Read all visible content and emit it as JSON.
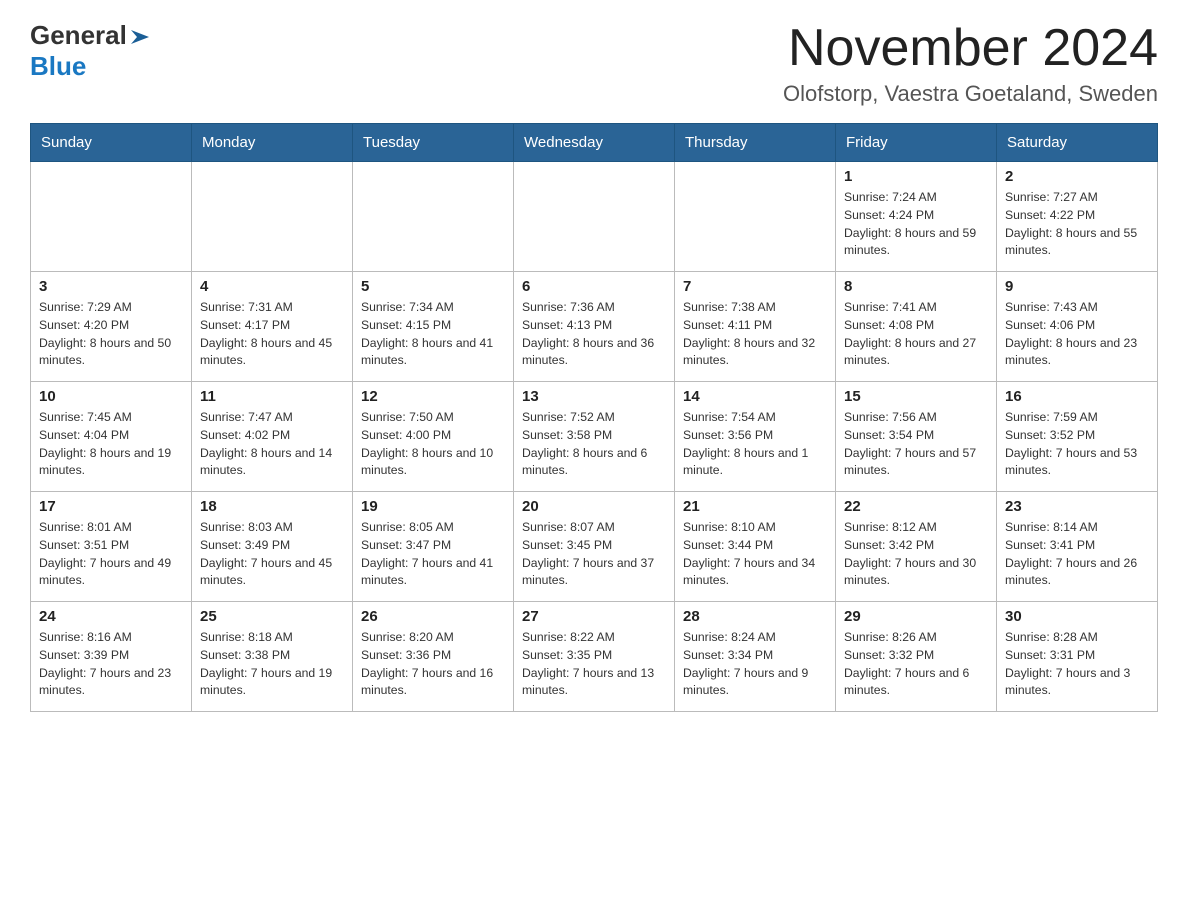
{
  "header": {
    "logo": {
      "text1": "General",
      "text2": "Blue"
    },
    "title": "November 2024",
    "subtitle": "Olofstorp, Vaestra Goetaland, Sweden"
  },
  "days_of_week": [
    "Sunday",
    "Monday",
    "Tuesday",
    "Wednesday",
    "Thursday",
    "Friday",
    "Saturday"
  ],
  "weeks": [
    [
      {
        "day": "",
        "info": ""
      },
      {
        "day": "",
        "info": ""
      },
      {
        "day": "",
        "info": ""
      },
      {
        "day": "",
        "info": ""
      },
      {
        "day": "",
        "info": ""
      },
      {
        "day": "1",
        "info": "Sunrise: 7:24 AM\nSunset: 4:24 PM\nDaylight: 8 hours and 59 minutes."
      },
      {
        "day": "2",
        "info": "Sunrise: 7:27 AM\nSunset: 4:22 PM\nDaylight: 8 hours and 55 minutes."
      }
    ],
    [
      {
        "day": "3",
        "info": "Sunrise: 7:29 AM\nSunset: 4:20 PM\nDaylight: 8 hours and 50 minutes."
      },
      {
        "day": "4",
        "info": "Sunrise: 7:31 AM\nSunset: 4:17 PM\nDaylight: 8 hours and 45 minutes."
      },
      {
        "day": "5",
        "info": "Sunrise: 7:34 AM\nSunset: 4:15 PM\nDaylight: 8 hours and 41 minutes."
      },
      {
        "day": "6",
        "info": "Sunrise: 7:36 AM\nSunset: 4:13 PM\nDaylight: 8 hours and 36 minutes."
      },
      {
        "day": "7",
        "info": "Sunrise: 7:38 AM\nSunset: 4:11 PM\nDaylight: 8 hours and 32 minutes."
      },
      {
        "day": "8",
        "info": "Sunrise: 7:41 AM\nSunset: 4:08 PM\nDaylight: 8 hours and 27 minutes."
      },
      {
        "day": "9",
        "info": "Sunrise: 7:43 AM\nSunset: 4:06 PM\nDaylight: 8 hours and 23 minutes."
      }
    ],
    [
      {
        "day": "10",
        "info": "Sunrise: 7:45 AM\nSunset: 4:04 PM\nDaylight: 8 hours and 19 minutes."
      },
      {
        "day": "11",
        "info": "Sunrise: 7:47 AM\nSunset: 4:02 PM\nDaylight: 8 hours and 14 minutes."
      },
      {
        "day": "12",
        "info": "Sunrise: 7:50 AM\nSunset: 4:00 PM\nDaylight: 8 hours and 10 minutes."
      },
      {
        "day": "13",
        "info": "Sunrise: 7:52 AM\nSunset: 3:58 PM\nDaylight: 8 hours and 6 minutes."
      },
      {
        "day": "14",
        "info": "Sunrise: 7:54 AM\nSunset: 3:56 PM\nDaylight: 8 hours and 1 minute."
      },
      {
        "day": "15",
        "info": "Sunrise: 7:56 AM\nSunset: 3:54 PM\nDaylight: 7 hours and 57 minutes."
      },
      {
        "day": "16",
        "info": "Sunrise: 7:59 AM\nSunset: 3:52 PM\nDaylight: 7 hours and 53 minutes."
      }
    ],
    [
      {
        "day": "17",
        "info": "Sunrise: 8:01 AM\nSunset: 3:51 PM\nDaylight: 7 hours and 49 minutes."
      },
      {
        "day": "18",
        "info": "Sunrise: 8:03 AM\nSunset: 3:49 PM\nDaylight: 7 hours and 45 minutes."
      },
      {
        "day": "19",
        "info": "Sunrise: 8:05 AM\nSunset: 3:47 PM\nDaylight: 7 hours and 41 minutes."
      },
      {
        "day": "20",
        "info": "Sunrise: 8:07 AM\nSunset: 3:45 PM\nDaylight: 7 hours and 37 minutes."
      },
      {
        "day": "21",
        "info": "Sunrise: 8:10 AM\nSunset: 3:44 PM\nDaylight: 7 hours and 34 minutes."
      },
      {
        "day": "22",
        "info": "Sunrise: 8:12 AM\nSunset: 3:42 PM\nDaylight: 7 hours and 30 minutes."
      },
      {
        "day": "23",
        "info": "Sunrise: 8:14 AM\nSunset: 3:41 PM\nDaylight: 7 hours and 26 minutes."
      }
    ],
    [
      {
        "day": "24",
        "info": "Sunrise: 8:16 AM\nSunset: 3:39 PM\nDaylight: 7 hours and 23 minutes."
      },
      {
        "day": "25",
        "info": "Sunrise: 8:18 AM\nSunset: 3:38 PM\nDaylight: 7 hours and 19 minutes."
      },
      {
        "day": "26",
        "info": "Sunrise: 8:20 AM\nSunset: 3:36 PM\nDaylight: 7 hours and 16 minutes."
      },
      {
        "day": "27",
        "info": "Sunrise: 8:22 AM\nSunset: 3:35 PM\nDaylight: 7 hours and 13 minutes."
      },
      {
        "day": "28",
        "info": "Sunrise: 8:24 AM\nSunset: 3:34 PM\nDaylight: 7 hours and 9 minutes."
      },
      {
        "day": "29",
        "info": "Sunrise: 8:26 AM\nSunset: 3:32 PM\nDaylight: 7 hours and 6 minutes."
      },
      {
        "day": "30",
        "info": "Sunrise: 8:28 AM\nSunset: 3:31 PM\nDaylight: 7 hours and 3 minutes."
      }
    ]
  ]
}
